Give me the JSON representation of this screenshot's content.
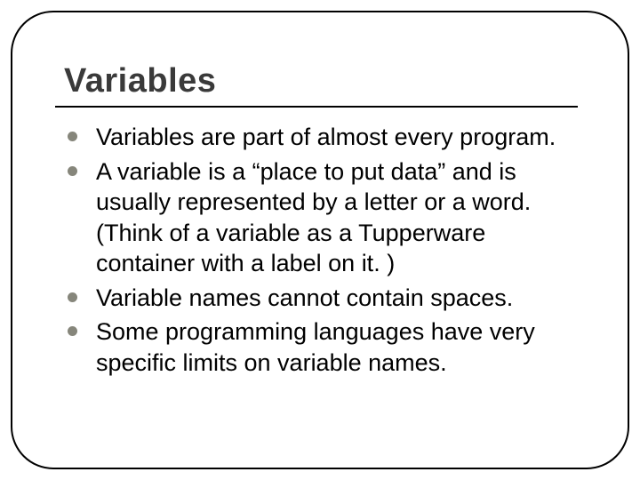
{
  "slide": {
    "title": "Variables",
    "bullets": [
      "Variables are part of almost every program.",
      "A variable is a “place to put data” and is usually represented by a letter or a word. (Think of a variable as a Tupperware container with a label on it. )",
      "Variable names cannot contain spaces.",
      "Some programming languages have very specific limits on variable names."
    ]
  }
}
